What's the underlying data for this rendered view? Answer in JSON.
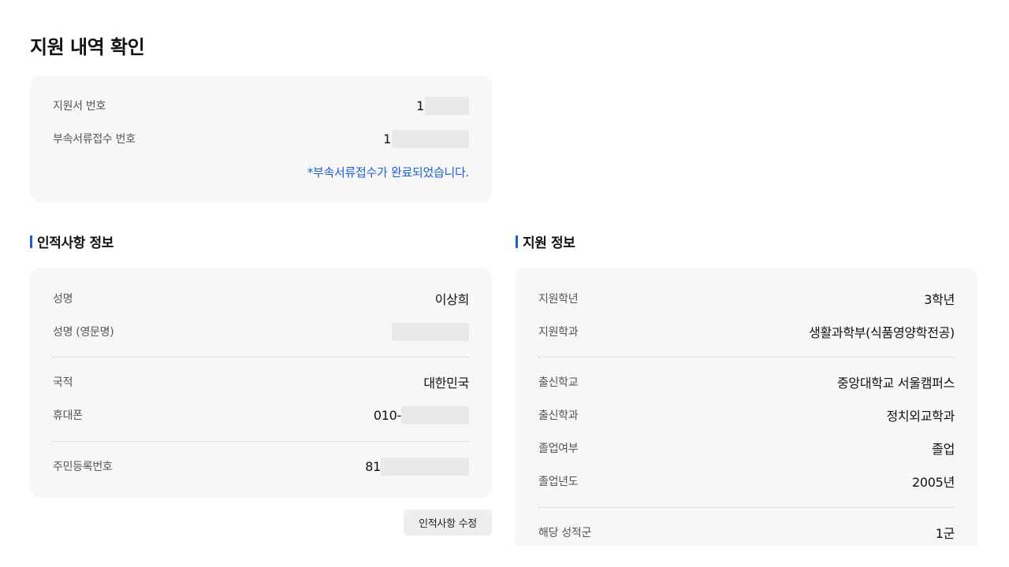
{
  "page": {
    "title": "지원 내역 확인"
  },
  "receipt": {
    "application_number_label": "지원서 번호",
    "application_number_value": "1",
    "document_number_label": "부속서류접수 번호",
    "document_number_value": "1",
    "notice": "*부속서류접수가 완료되었습니다."
  },
  "personal": {
    "section_title": "인적사항 정보",
    "name_label": "성명",
    "name_value": "이상희",
    "english_name_label": "성명 (영문명)",
    "nationality_label": "국적",
    "nationality_value": "대한민국",
    "phone_label": "휴대폰",
    "phone_value": "010-",
    "resident_number_label": "주민등록번호",
    "resident_number_value": "81",
    "edit_button_label": "인적사항 수정"
  },
  "application": {
    "section_title": "지원 정보",
    "grade_label": "지원학년",
    "grade_value": "3학년",
    "department_label": "지원학과",
    "department_value": "생활과학부(식품영양학전공)",
    "school_label": "출신학교",
    "school_value": "중앙대학교 서울캠퍼스",
    "major_label": "출신학과",
    "major_value": "정치외교학과",
    "graduation_status_label": "졸업여부",
    "graduation_status_value": "졸업",
    "graduation_year_label": "졸업년도",
    "graduation_year_value": "2005년",
    "group_label": "해당 성적군",
    "group_value": "1군"
  },
  "colors": {
    "accent": "#1a5fd6",
    "card_bg": "#f7f7f8",
    "mask_bg": "#e9e9ea"
  }
}
